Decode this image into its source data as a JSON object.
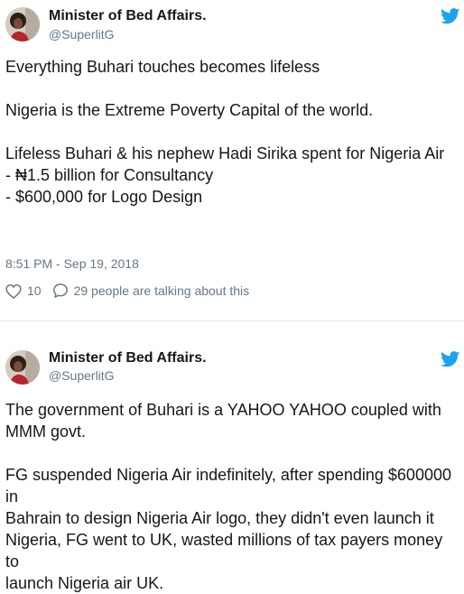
{
  "tweets": [
    {
      "author_name": "Minister of Bed Affairs.",
      "handle": "@SuperlitG",
      "lines": [
        "Everything Buhari touches becomes lifeless",
        "",
        "Nigeria is the Extreme Poverty Capital of the world.",
        "",
        "Lifeless Buhari & his nephew Hadi Sirika spent for Nigeria Air",
        "- ₦1.5 billion for Consultancy",
        "- $600,000 for Logo Design"
      ],
      "timestamp": "8:51 PM - Sep 19, 2018",
      "like_count": "10",
      "talking_text": "29 people are talking about this"
    },
    {
      "author_name": "Minister of Bed Affairs.",
      "handle": "@SuperlitG",
      "lines": [
        "The government of Buhari is a YAHOO YAHOO coupled with",
        "MMM govt.",
        "",
        "FG suspended Nigeria Air indefinitely, after spending $600000 in",
        "Bahrain to design Nigeria Air logo, they didn't even launch it",
        "Nigeria, FG went to UK, wasted millions of tax payers money to",
        "launch Nigeria air UK."
      ]
    }
  ],
  "colors": {
    "text": "#14171a",
    "secondary": "#657786",
    "twitter_blue": "#1da1f2",
    "separator": "#e1e8ed"
  },
  "icons": {
    "bird": "twitter-bird-icon",
    "like": "heart-icon",
    "reply": "speech-bubble-icon"
  }
}
